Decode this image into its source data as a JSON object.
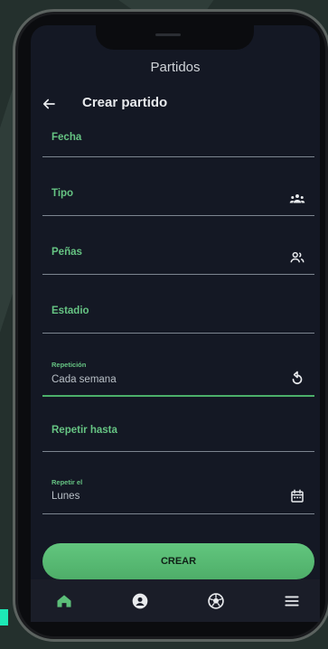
{
  "header": {
    "top_title": "Partidos",
    "title": "Crear partido"
  },
  "form": {
    "fecha": {
      "label": "Fecha"
    },
    "tipo": {
      "label": "Tipo"
    },
    "penas": {
      "label": "Peñas"
    },
    "estadio": {
      "label": "Estadio"
    },
    "repeticion": {
      "label": "Repetición",
      "value": "Cada semana"
    },
    "repetir_hasta": {
      "label": "Repetir hasta"
    },
    "repetir_el": {
      "label": "Repetir el",
      "value": "Lunes"
    }
  },
  "actions": {
    "create_label": "CREAR"
  },
  "nav": {
    "items": [
      {
        "icon": "home-icon",
        "active": true
      },
      {
        "icon": "team-icon"
      },
      {
        "icon": "soccer-ball-icon"
      },
      {
        "icon": "menu-icon"
      }
    ]
  },
  "colors": {
    "accent": "#66c483",
    "button": "#5cbf79",
    "screen_bg": "#141824",
    "background": "#24302d"
  }
}
